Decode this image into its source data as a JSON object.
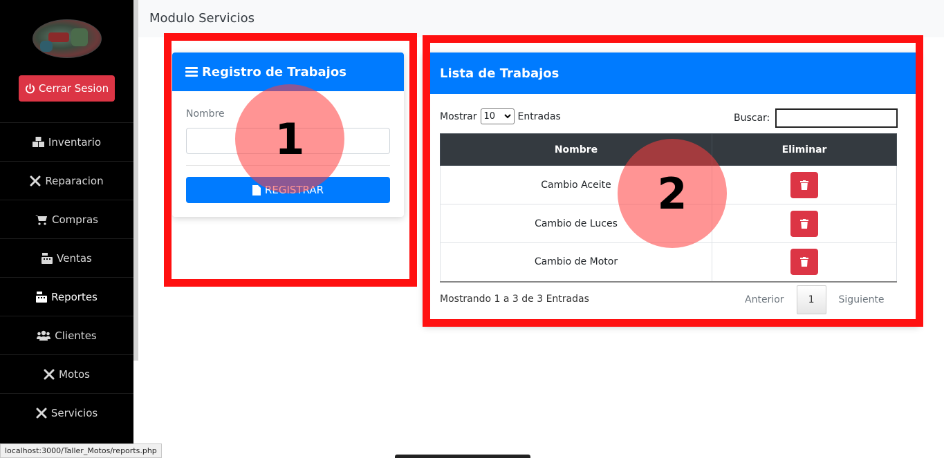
{
  "sidebar": {
    "logout_label": "Cerrar Sesion",
    "items": [
      {
        "label": "Inventario",
        "icon": "boxes-icon"
      },
      {
        "label": "Reparacion",
        "icon": "tools-icon"
      },
      {
        "label": "Compras",
        "icon": "cart-icon"
      },
      {
        "label": "Ventas",
        "icon": "cash-register-icon"
      },
      {
        "label": "Reportes",
        "icon": "cash-register-icon"
      },
      {
        "label": "Clientes",
        "icon": "users-icon"
      },
      {
        "label": "Motos",
        "icon": "tools-icon"
      },
      {
        "label": "Servicios",
        "icon": "tools-icon"
      }
    ]
  },
  "header": {
    "title": "Modulo Servicios"
  },
  "register_card": {
    "title": "Registro de Trabajos",
    "name_label": "Nombre",
    "name_value": "",
    "submit_label": "REGISTRAR"
  },
  "list_card": {
    "title": "Lista de Trabajos",
    "show_label": "Mostrar",
    "page_size": "10",
    "entries_label": "Entradas",
    "search_label": "Buscar:",
    "search_value": "",
    "columns": [
      "Nombre",
      "Eliminar"
    ],
    "rows": [
      {
        "nombre": "Cambio Aceite"
      },
      {
        "nombre": "Cambio de Luces"
      },
      {
        "nombre": "Cambio de Motor"
      }
    ],
    "info": "Mostrando 1 a 3 de 3 Entradas",
    "pagination": {
      "prev": "Anterior",
      "current": "1",
      "next": "Siguiente"
    }
  },
  "annotations": {
    "marker1": "1",
    "marker2": "2"
  },
  "statusbar": {
    "url": "localhost:3000/Taller_Motos/reports.php"
  },
  "colors": {
    "primary": "#007bff",
    "danger": "#dc3545",
    "sidebar": "#000000",
    "annotation": "#ff1010"
  }
}
